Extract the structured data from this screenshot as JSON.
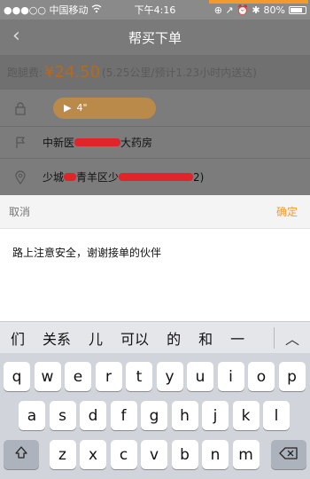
{
  "status_bar": {
    "carrier": "●●●○○ 中国移动",
    "wifi_icon": "wifi",
    "time": "下午4:16",
    "battery_text": "80%",
    "status_icons": "⊕ ↗ ⏰ ✱"
  },
  "nav": {
    "back_icon": "chevron-left",
    "title": "帮买下单"
  },
  "fee": {
    "label": "跑腿费:",
    "currency": "¥",
    "amount": "24.50",
    "detail": "(5.25公里/预计1.23小时内送达)"
  },
  "voice": {
    "duration": "4\""
  },
  "rows": [
    {
      "icon": "flag",
      "text_prefix": "中新医",
      "text_suffix": "大药房"
    },
    {
      "icon": "location-pin",
      "text_prefix": "少城",
      "text_mid": "青羊区少",
      "text_suffix": "2)"
    }
  ],
  "sheet": {
    "cancel": "取消",
    "confirm": "确定",
    "note": "路上注意安全，谢谢接单的伙伴"
  },
  "candidates": [
    "们",
    "关系",
    "儿",
    "可以",
    "的",
    "和",
    "一"
  ],
  "candidate_expand_icon": "chevron-up",
  "keyboard": {
    "row1": [
      "q",
      "w",
      "e",
      "r",
      "t",
      "y",
      "u",
      "i",
      "o",
      "p"
    ],
    "row2": [
      "a",
      "s",
      "d",
      "f",
      "g",
      "h",
      "j",
      "k",
      "l"
    ],
    "row3": [
      "z",
      "x",
      "c",
      "v",
      "b",
      "n",
      "m"
    ],
    "shift_icon": "shift",
    "delete_icon": "backspace"
  },
  "colors": {
    "accent": "#f39a2c",
    "fee_amount": "#b46a1e",
    "scribble": "#e0242a"
  }
}
